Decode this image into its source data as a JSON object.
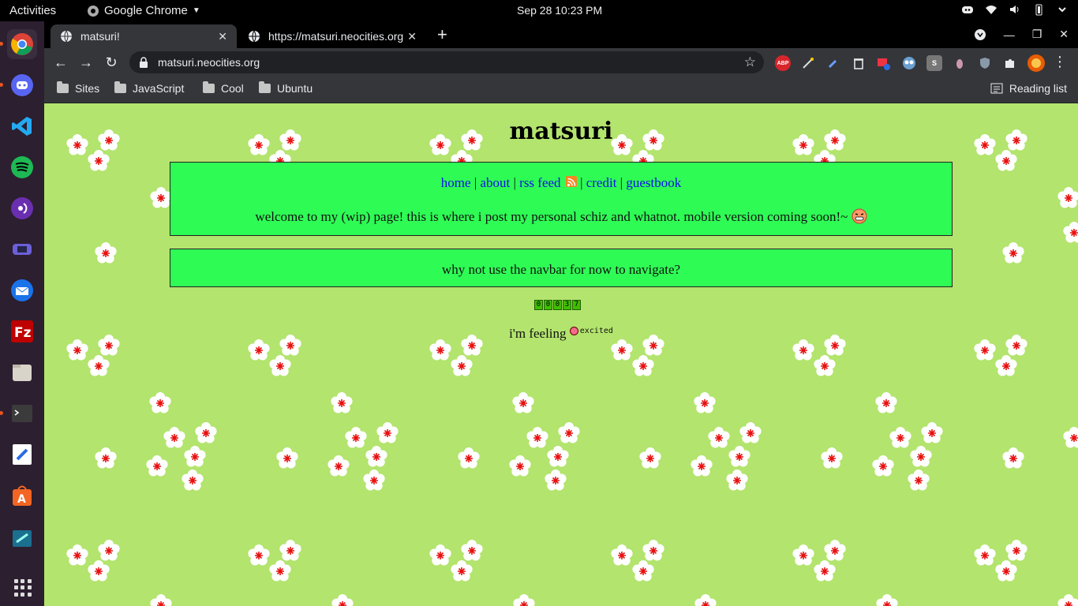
{
  "system_bar": {
    "activities": "Activities",
    "app_name": "Google Chrome",
    "clock": "Sep 28  10:23 PM"
  },
  "browser": {
    "tabs": [
      {
        "title": "matsuri!",
        "active": true
      },
      {
        "title": "https://matsuri.neocities.org",
        "active": false
      }
    ],
    "url": "matsuri.neocities.org",
    "extensions": [
      "ABP",
      "S"
    ],
    "bookmarks": [
      "Sites",
      "JavaScript",
      "Cool",
      "Ubuntu"
    ],
    "reading_list": "Reading list"
  },
  "page": {
    "title": "matsuri",
    "nav": {
      "home": "home",
      "about": "about",
      "rss": "rss feed",
      "credit": "credit",
      "guestbook": "guestbook",
      "separator": "|"
    },
    "welcome": "welcome to my (wip) page! this is where i post my personal schiz and whatnot. mobile version coming soon!~",
    "navbar_hint": "why not use the navbar for now to navigate?",
    "counter_digits": [
      "0",
      "0",
      "0",
      "3",
      "7"
    ],
    "feeling_prefix": "i'm feeling",
    "mood": "excited"
  },
  "colors": {
    "page_background": "#b3e46e",
    "box_background": "#2efc55",
    "link": "#1010e8",
    "flower_center": "#e81010"
  }
}
